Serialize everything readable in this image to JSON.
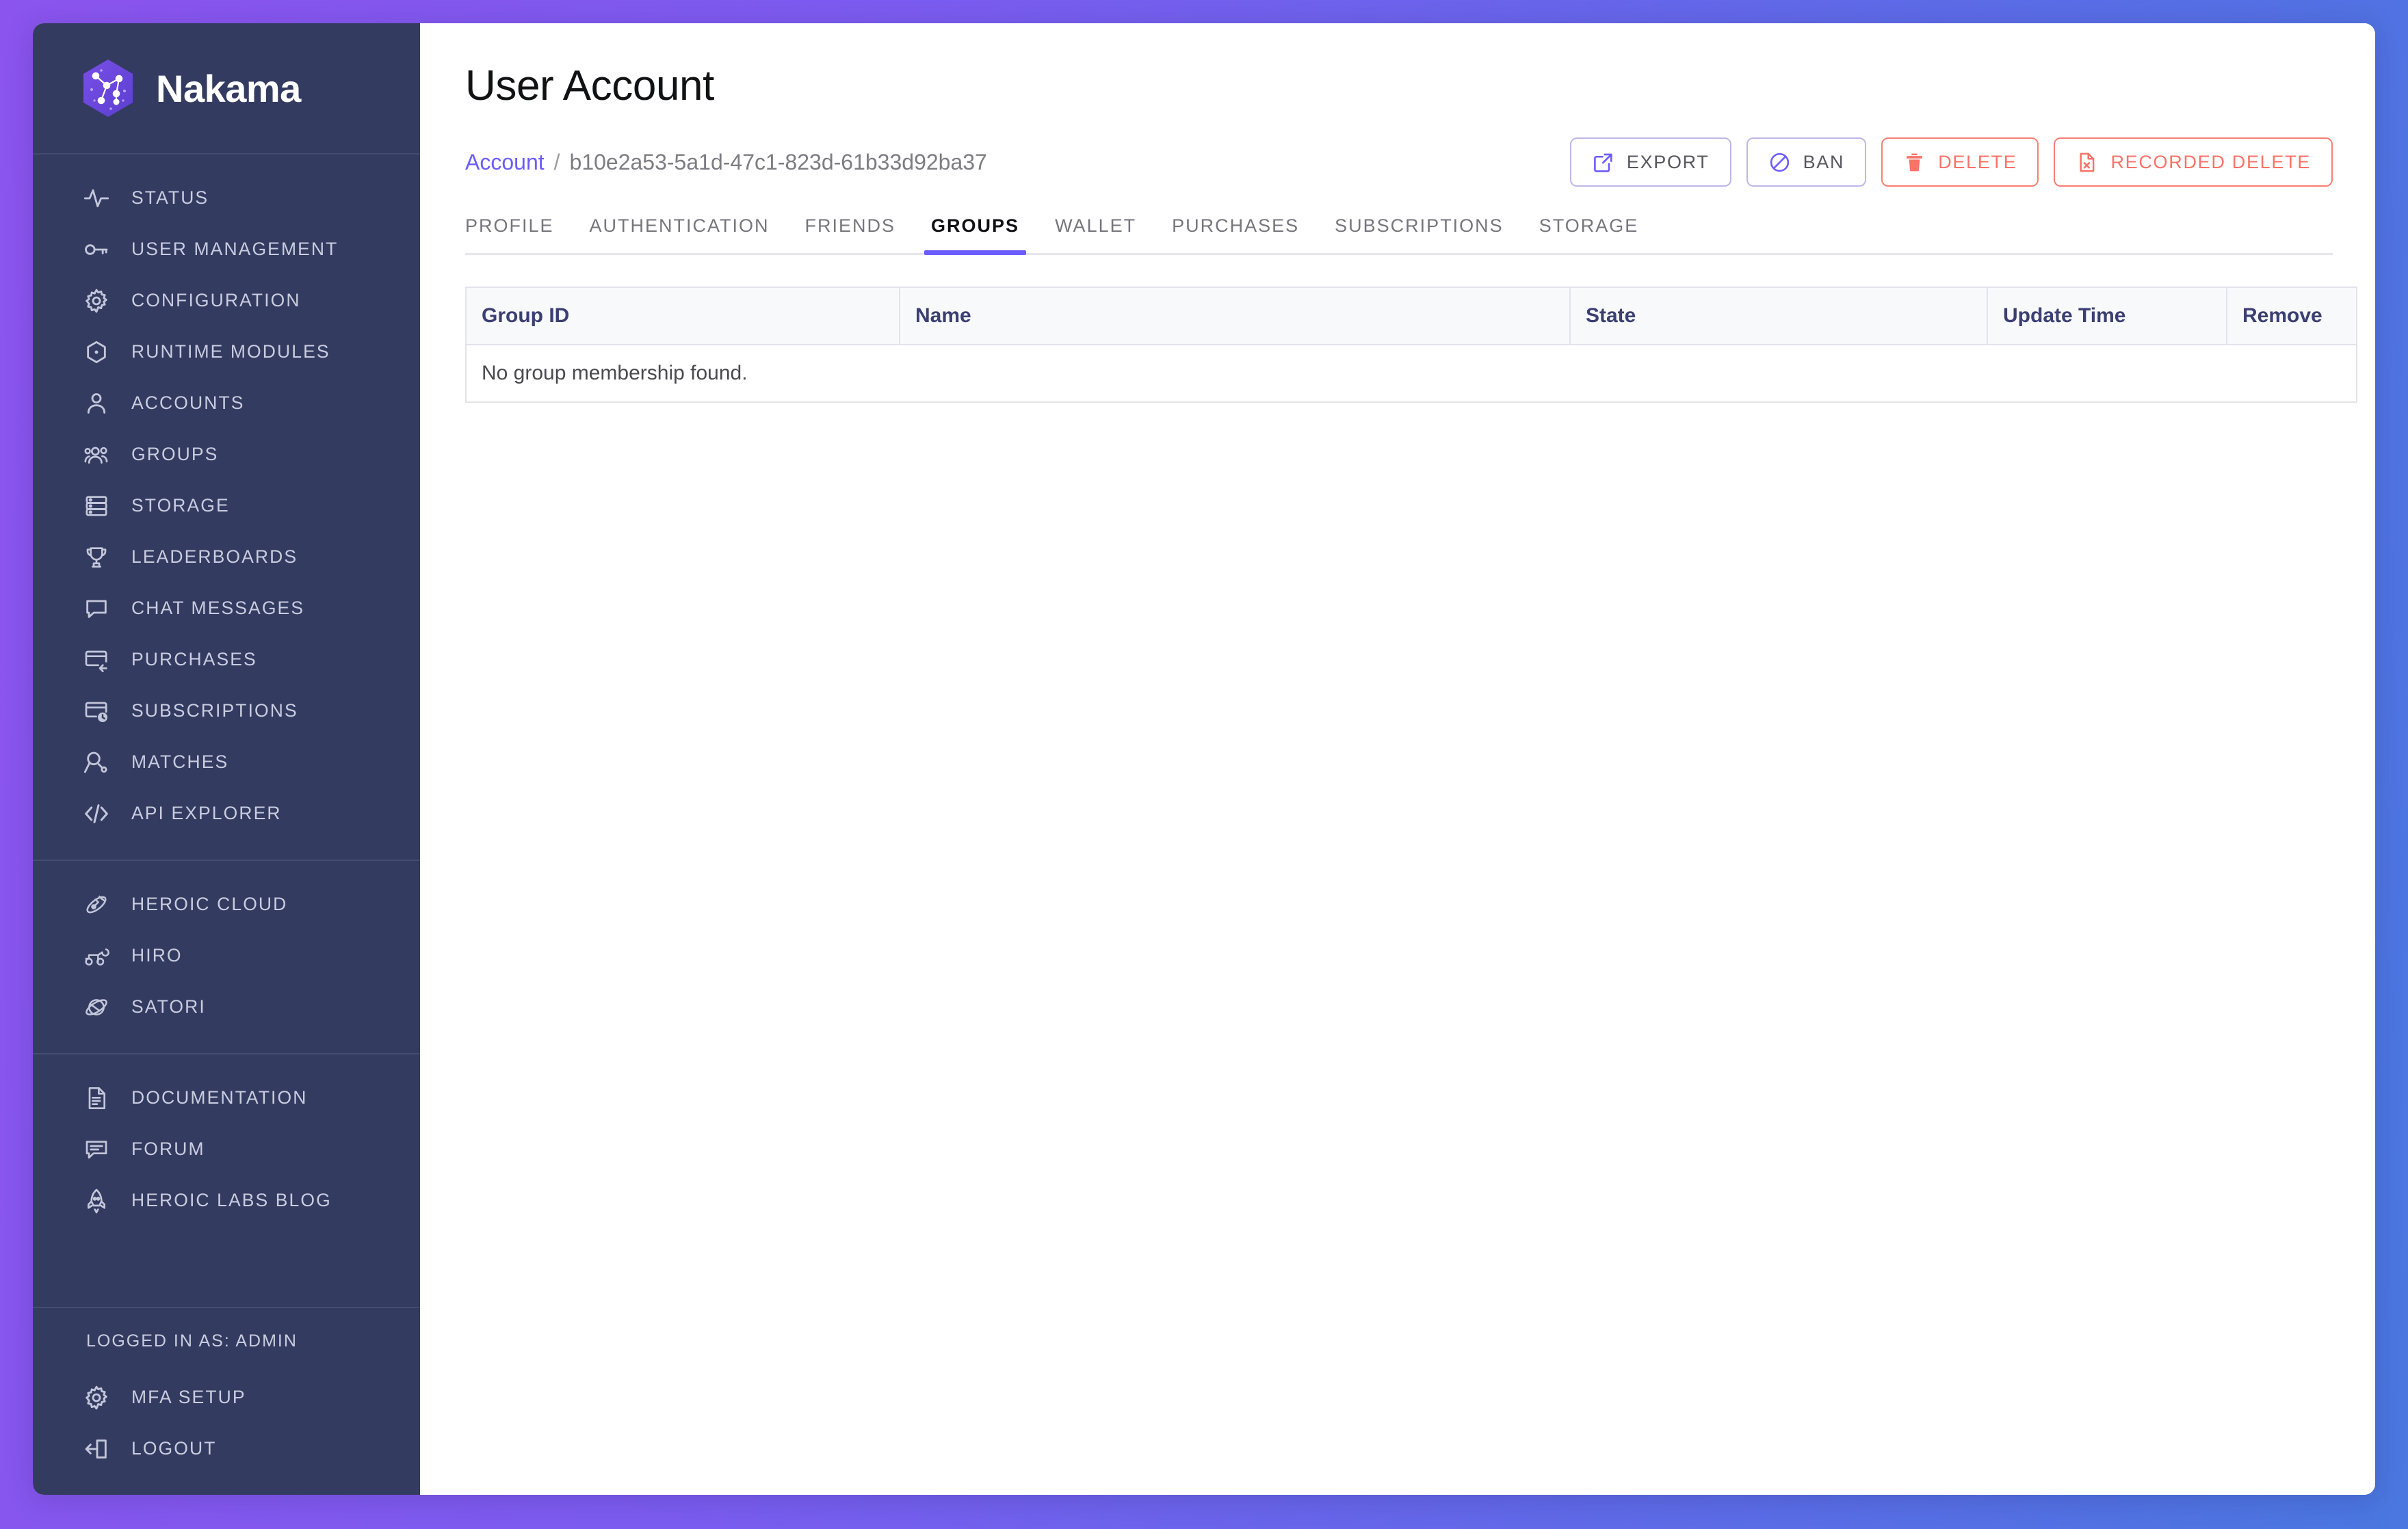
{
  "brand": {
    "name": "Nakama",
    "logo_icon": "nakama-hexagon-constellation-icon"
  },
  "sidebar": {
    "groups": [
      {
        "id": "primary",
        "items": [
          {
            "label": "STATUS",
            "icon": "activity-pulse-icon"
          },
          {
            "label": "USER MANAGEMENT",
            "icon": "key-icon"
          },
          {
            "label": "CONFIGURATION",
            "icon": "gear-icon"
          },
          {
            "label": "RUNTIME MODULES",
            "icon": "hexagon-dot-icon"
          },
          {
            "label": "ACCOUNTS",
            "icon": "person-icon"
          },
          {
            "label": "GROUPS",
            "icon": "people-group-icon"
          },
          {
            "label": "STORAGE",
            "icon": "database-stack-icon"
          },
          {
            "label": "LEADERBOARDS",
            "icon": "trophy-icon"
          },
          {
            "label": "CHAT MESSAGES",
            "icon": "speech-bubble-icon"
          },
          {
            "label": "PURCHASES",
            "icon": "credit-card-arrow-icon"
          },
          {
            "label": "SUBSCRIPTIONS",
            "icon": "credit-card-clock-icon"
          },
          {
            "label": "MATCHES",
            "icon": "person-search-icon"
          },
          {
            "label": "API EXPLORER",
            "icon": "code-brackets-icon"
          }
        ]
      },
      {
        "id": "products",
        "items": [
          {
            "label": "HEROIC CLOUD",
            "icon": "satellite-icon"
          },
          {
            "label": "HIRO",
            "icon": "rover-icon"
          },
          {
            "label": "SATORI",
            "icon": "planet-orbit-icon"
          }
        ]
      },
      {
        "id": "resources",
        "items": [
          {
            "label": "DOCUMENTATION",
            "icon": "document-icon"
          },
          {
            "label": "FORUM",
            "icon": "comment-icon"
          },
          {
            "label": "HEROIC LABS BLOG",
            "icon": "rocket-icon"
          }
        ]
      }
    ],
    "footer": {
      "logged_in_as": "LOGGED IN AS: ADMIN",
      "items": [
        {
          "label": "MFA SETUP",
          "icon": "gear-icon"
        },
        {
          "label": "LOGOUT",
          "icon": "logout-arrow-icon"
        }
      ]
    }
  },
  "header": {
    "title": "User Account",
    "breadcrumb": {
      "link_label": "Account",
      "separator": "/",
      "current_id": "b10e2a53-5a1d-47c1-823d-61b33d92ba37"
    },
    "actions": [
      {
        "label": "EXPORT",
        "icon": "external-link-icon",
        "style": "neutral"
      },
      {
        "label": "BAN",
        "icon": "circle-slash-icon",
        "style": "neutral"
      },
      {
        "label": "DELETE",
        "icon": "trash-icon",
        "style": "danger"
      },
      {
        "label": "RECORDED DELETE",
        "icon": "file-x-icon",
        "style": "danger"
      }
    ]
  },
  "tabs": {
    "items": [
      {
        "label": "PROFILE",
        "active": false
      },
      {
        "label": "AUTHENTICATION",
        "active": false
      },
      {
        "label": "FRIENDS",
        "active": false
      },
      {
        "label": "GROUPS",
        "active": true
      },
      {
        "label": "WALLET",
        "active": false
      },
      {
        "label": "PURCHASES",
        "active": false
      },
      {
        "label": "SUBSCRIPTIONS",
        "active": false
      },
      {
        "label": "STORAGE",
        "active": false
      }
    ]
  },
  "groups_table": {
    "columns": [
      "Group ID",
      "Name",
      "State",
      "Update Time",
      "Remove"
    ],
    "rows": [],
    "empty_message": "No group membership found."
  },
  "colors": {
    "accent_purple": "#6c5cfc",
    "danger_salmon": "#fa7268",
    "sidebar_bg": "#343b61",
    "header_text": "#3b3f72",
    "bg_gradient_from": "#8b54ee",
    "bg_gradient_to": "#4a77e0"
  }
}
